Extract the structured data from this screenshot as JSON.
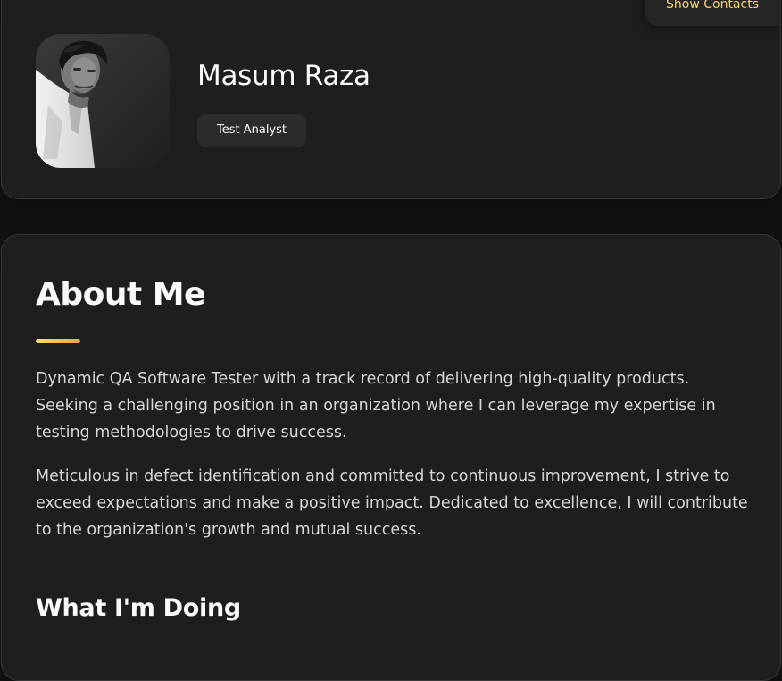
{
  "profile": {
    "name": "Masum Raza",
    "role": "Test Analyst",
    "show_contacts_label": "Show Contacts"
  },
  "about": {
    "title": "About Me",
    "paragraphs": [
      "Dynamic QA Software Tester with a track record of delivering high-quality products. Seeking a challenging position in an organization where I can leverage my expertise in testing methodologies to drive success.",
      "Meticulous in defect identification and committed to continuous improvement, I strive to exceed expectations and make a positive impact. Dedicated to excellence, I will contribute to the organization's growth and mutual success."
    ],
    "section_title": "What I'm Doing"
  },
  "colors": {
    "accent": "#fbd16a",
    "background": "#121212",
    "card": "#1e1e1f"
  },
  "icons": {
    "avatar": "profile-photo"
  }
}
